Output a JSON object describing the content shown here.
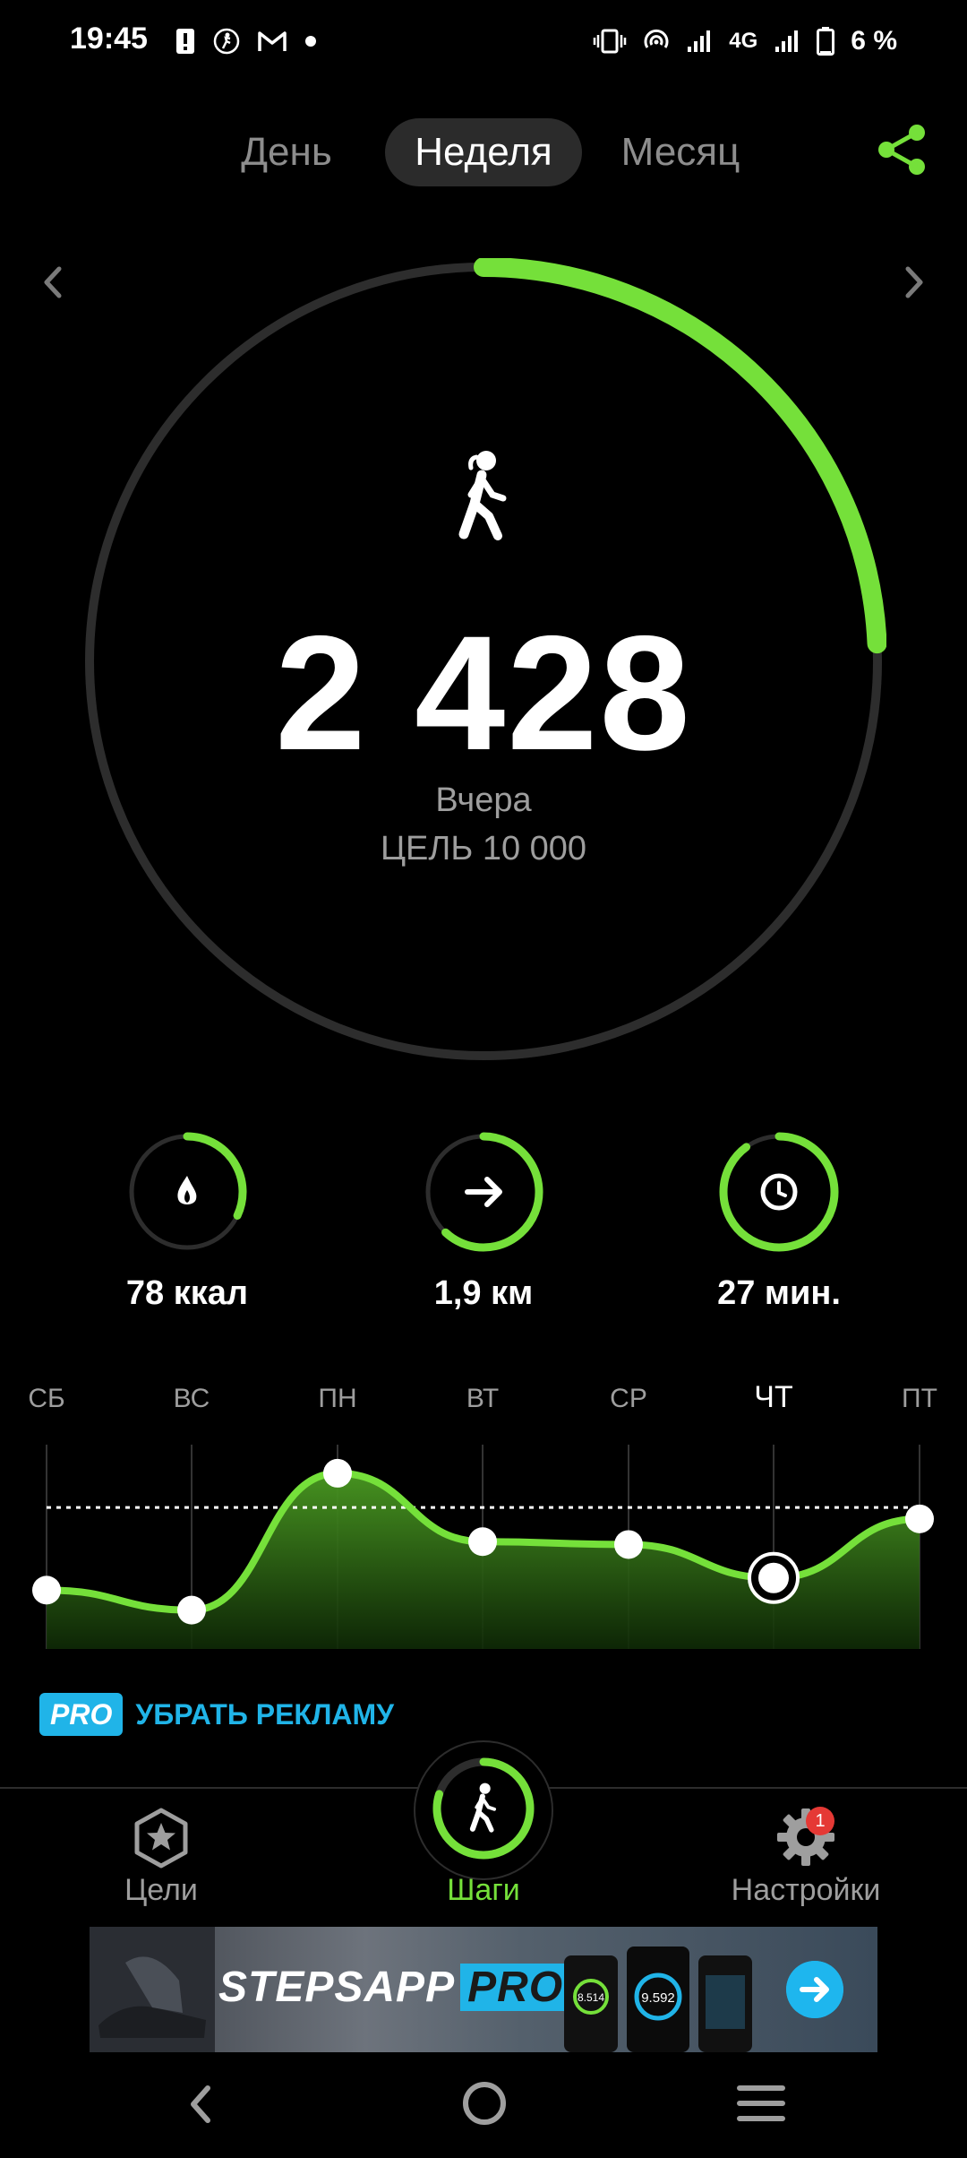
{
  "status_bar": {
    "time": "19:45",
    "left_icons": [
      "alert-icon",
      "accessibility-icon",
      "gmail-icon",
      "dot-icon"
    ],
    "right_icons": [
      "vibrate-icon",
      "hotspot-icon",
      "signal-icon",
      "signal-4g-icon",
      "battery-icon"
    ],
    "network": "4G",
    "battery": "6 %"
  },
  "tabs": [
    {
      "label": "День",
      "active": false
    },
    {
      "label": "Неделя",
      "active": true
    },
    {
      "label": "Месяц",
      "active": false
    }
  ],
  "share": {
    "icon": "share-icon"
  },
  "progress": {
    "steps": "2 428",
    "period": "Вчера",
    "goal_text": "ЦЕЛЬ 10 000",
    "fraction": 0.2428,
    "accent": "#75e03a",
    "track": "#2d2d2d"
  },
  "stats": [
    {
      "label": "78 ккал",
      "icon": "flame-icon",
      "fraction": 0.32
    },
    {
      "label": "1,9 км",
      "icon": "arrow-right-icon",
      "fraction": 0.62
    },
    {
      "label": "27 мин.",
      "icon": "clock-icon",
      "fraction": 0.9
    }
  ],
  "chart_data": {
    "type": "area",
    "categories": [
      "СБ",
      "ВС",
      "ПН",
      "ВТ",
      "СР",
      "ЧТ",
      "ПТ"
    ],
    "values": [
      2000,
      1300,
      6100,
      3700,
      3600,
      2428,
      4500
    ],
    "goal_line": 4900,
    "selected": "ЧТ",
    "color": "#75e03a"
  },
  "pro": {
    "badge": "PRO",
    "text": "УБРАТЬ РЕКЛАМУ"
  },
  "bottom_nav": [
    {
      "label": "Цели",
      "icon": "star-badge-icon",
      "active": false
    },
    {
      "label": "Шаги",
      "icon": "walker-icon",
      "active": true
    },
    {
      "label": "Настройки",
      "icon": "gear-icon",
      "active": false,
      "badge": "1"
    }
  ],
  "ad": {
    "title_main": "STEPSAPP",
    "title_pro": "PRO",
    "phone_values": [
      "8.514",
      "9.592"
    ]
  },
  "system_nav": [
    "back-icon",
    "home-icon",
    "menu-icon"
  ]
}
